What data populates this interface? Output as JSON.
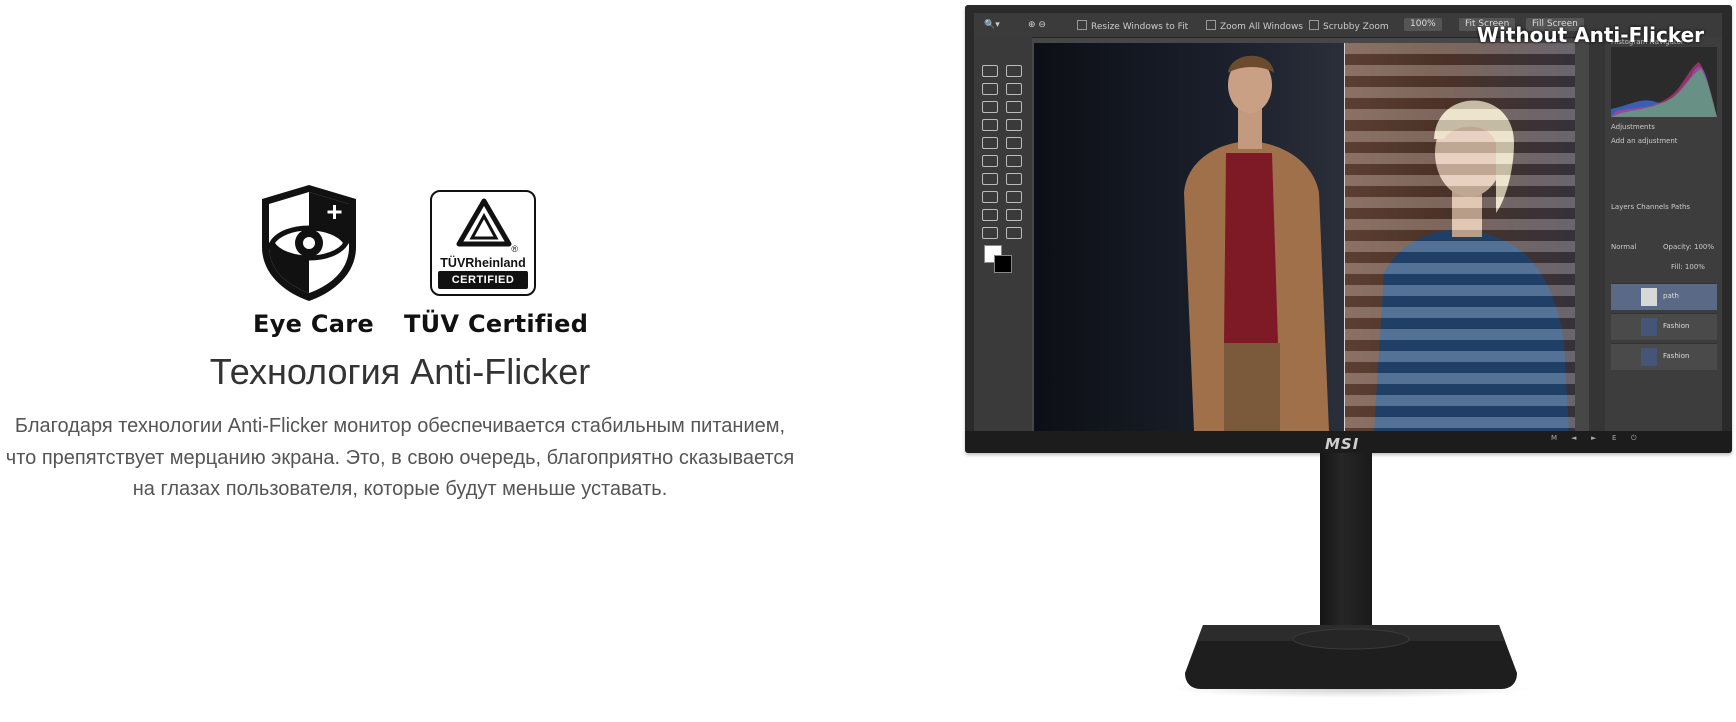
{
  "badges": {
    "eye_care_label": "Eye Care",
    "tuv_label": "TÜV Certified",
    "tuv_brand": "TÜVRheinland",
    "tuv_certified": "CERTIFIED",
    "tuv_registered": "®"
  },
  "section": {
    "heading": "Технология Anti-Flicker",
    "description": "Благодаря технологии Anti-Flicker монитор обеспечивается стабильным питанием, что препятствует мерцанию экрана. Это, в свою очередь, благоприятно сказывается на глазах пользователя, которые будут меньше уставать."
  },
  "monitor": {
    "brand": "MSI",
    "overlay_label": "Without Anti-Flicker",
    "toolbar": {
      "resize_windows": "Resize Windows to Fit",
      "zoom_all": "Zoom All Windows",
      "scrubby_zoom": "Scrubby Zoom",
      "zoom_100": "100%",
      "fit_screen": "Fit Screen",
      "fill_screen": "Fill Screen"
    },
    "panels": {
      "histogram_tab": "Histogram  Navigator",
      "adjustments_tab": "Adjustments",
      "add_adjustment": "Add an adjustment",
      "layers_tabs": "Layers  Channels  Paths",
      "blend_mode": "Normal",
      "opacity": "Opacity: 100%",
      "fill": "Fill: 100%",
      "layer_names": [
        "path",
        "Fashion",
        "Fashion"
      ]
    },
    "controls": [
      "M",
      "◄",
      "►",
      "E",
      "⏻"
    ]
  },
  "colors": {
    "heading": "#333333",
    "body_text": "#555555",
    "monitor_black": "#1c1c1c"
  }
}
